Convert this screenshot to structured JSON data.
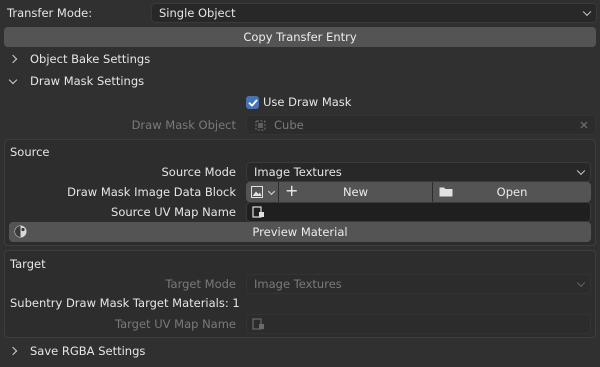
{
  "header": {
    "transfer_mode_label": "Transfer Mode:",
    "transfer_mode_value": "Single Object",
    "copy_button": "Copy Transfer Entry"
  },
  "sections": {
    "object_bake": "Object Bake Settings",
    "draw_mask": "Draw Mask Settings",
    "save_rgba": "Save RGBA Settings"
  },
  "draw_mask": {
    "use_draw_mask_label": "Use Draw Mask",
    "use_draw_mask_checked": true,
    "object_label": "Draw Mask Object",
    "object_value": "Cube"
  },
  "source": {
    "title": "Source",
    "mode_label": "Source Mode",
    "mode_value": "Image Textures",
    "image_block_label": "Draw Mask Image Data Block",
    "new_button": "New",
    "open_button": "Open",
    "uv_map_label": "Source UV Map Name",
    "uv_map_value": "",
    "preview_button": "Preview Material"
  },
  "target": {
    "title": "Target",
    "mode_label": "Target Mode",
    "mode_value": "Image Textures",
    "subentry_text": "Subentry Draw Mask Target Materials: 1",
    "uv_map_label": "Target UV Map Name",
    "uv_map_value": ""
  },
  "colors": {
    "background": "#303030",
    "field": "#282828",
    "button": "#545454",
    "checkbox": "#4772b3"
  }
}
